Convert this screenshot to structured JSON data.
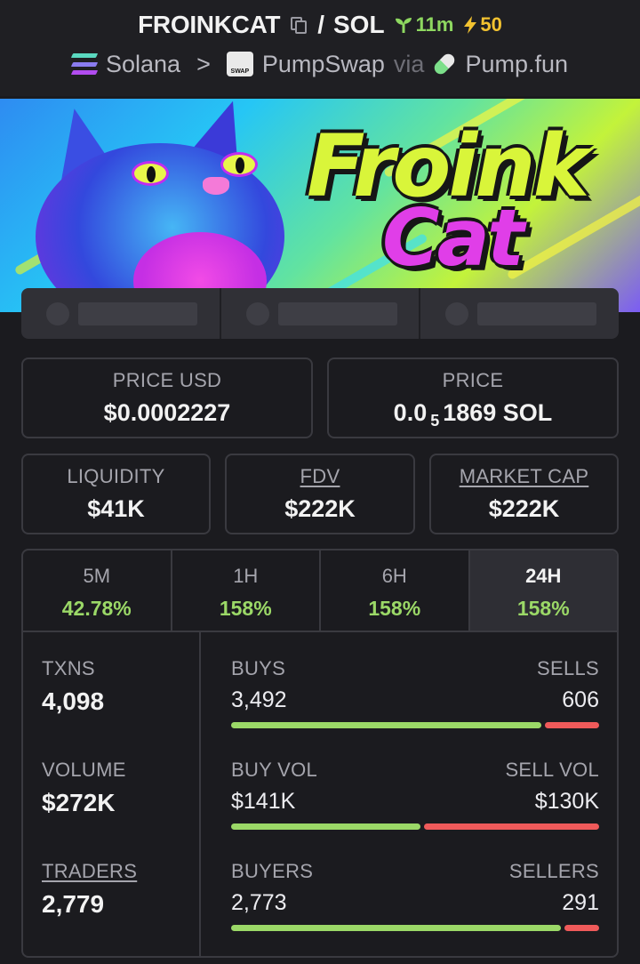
{
  "header": {
    "token": "FROINKCAT",
    "separator": "/",
    "quote": "SOL",
    "age": "11m",
    "boosts": "50",
    "chain": "Solana",
    "chevron": ">",
    "dex": "PumpSwap",
    "via": "via",
    "launchpad": "Pump.fun"
  },
  "banner": {
    "word1": "Froink",
    "word2": "Cat"
  },
  "stats": {
    "price_usd_label": "PRICE USD",
    "price_usd": "$0.0002227",
    "price_label": "PRICE",
    "price_prefix": "0.0",
    "price_subscript": "5",
    "price_suffix": "1869 SOL",
    "liquidity_label": "LIQUIDITY",
    "liquidity": "$41K",
    "fdv_label": "FDV",
    "fdv": "$222K",
    "mcap_label": "MARKET CAP",
    "mcap": "$222K"
  },
  "timeframes": [
    {
      "label": "5M",
      "change": "42.78%",
      "active": false
    },
    {
      "label": "1H",
      "change": "158%",
      "active": false
    },
    {
      "label": "6H",
      "change": "158%",
      "active": false
    },
    {
      "label": "24H",
      "change": "158%",
      "active": true
    }
  ],
  "activity": {
    "txns_label": "TXNS",
    "txns": "4,098",
    "volume_label": "VOLUME",
    "volume": "$272K",
    "traders_label": "TRADERS",
    "traders": "2,779",
    "buys_label": "BUYS",
    "buys": "3,492",
    "sells_label": "SELLS",
    "sells": "606",
    "buy_vol_label": "BUY VOL",
    "buy_vol": "$141K",
    "sell_vol_label": "SELL VOL",
    "sell_vol": "$130K",
    "buyers_label": "BUYERS",
    "buyers": "2,773",
    "sellers_label": "SELLERS",
    "sellers": "291",
    "buy_ratio_txns": 0.852,
    "buy_ratio_volume": 0.52,
    "buy_ratio_traders": 0.905
  },
  "colors": {
    "positive": "#9bd867",
    "negative": "#ef5a5a",
    "boost": "#f2c230",
    "age": "#8ed860"
  }
}
